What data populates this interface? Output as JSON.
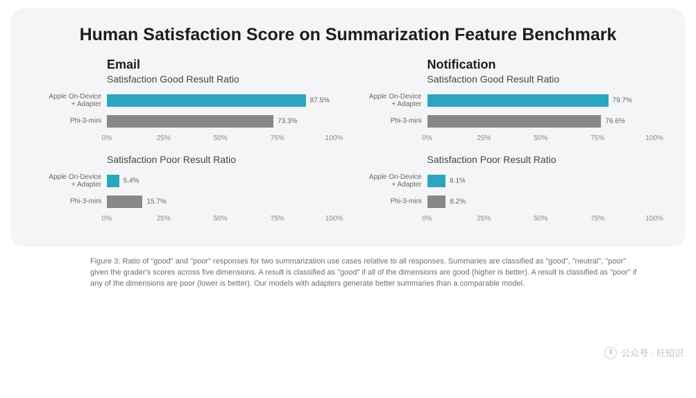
{
  "title": "Human Satisfaction Score on Summarization Feature Benchmark",
  "columns": [
    {
      "head": "Email",
      "good": {
        "sub": "Satisfaction Good Result Ratio",
        "rows": [
          {
            "label": "Apple On-Device\n+ Adapter",
            "value": 87.5,
            "text": "87.5%",
            "color": "teal"
          },
          {
            "label": "Phi-3-mini",
            "value": 73.3,
            "text": "73.3%",
            "color": "gray"
          }
        ]
      },
      "poor": {
        "sub": "Satisfaction Poor Result Ratio",
        "rows": [
          {
            "label": "Apple On-Device\n+ Adapter",
            "value": 5.4,
            "text": "5.4%",
            "color": "teal"
          },
          {
            "label": "Phi-3-mini",
            "value": 15.7,
            "text": "15.7%",
            "color": "gray"
          }
        ]
      }
    },
    {
      "head": "Notification",
      "good": {
        "sub": "Satisfaction Good Result Ratio",
        "rows": [
          {
            "label": "Apple On-Device\n+ Adapter",
            "value": 79.7,
            "text": "79.7%",
            "color": "teal"
          },
          {
            "label": "Phi-3-mini",
            "value": 76.6,
            "text": "76.6%",
            "color": "gray"
          }
        ]
      },
      "poor": {
        "sub": "Satisfaction Poor Result Ratio",
        "rows": [
          {
            "label": "Apple On-Device\n+ Adapter",
            "value": 8.1,
            "text": "8.1%",
            "color": "teal"
          },
          {
            "label": "Phi-3-mini",
            "value": 8.2,
            "text": "8.2%",
            "color": "gray"
          }
        ]
      }
    }
  ],
  "ticks": [
    "0%",
    "25%",
    "50%",
    "75%",
    "100%"
  ],
  "caption": "Figure 3: Ratio of \"good\" and \"poor\" responses for two summarization use cases relative to all responses. Summaries are classified as \"good\", \"neutral\", \"poor\" given the grader's scores across five dimensions. A result is classified as \"good\" if all of the dimensions are good (higher is better). A result is classified as \"poor\" if any of the dimensions are poor (lower is better). Our models with adapters generate better summaries than a comparable model.",
  "watermark": "公众号 · 旺知识",
  "chart_data": [
    {
      "type": "bar",
      "title": "Email — Satisfaction Good Result Ratio",
      "categories": [
        "Apple On-Device + Adapter",
        "Phi-3-mini"
      ],
      "values": [
        87.5,
        73.3
      ],
      "xlabel": "",
      "ylabel": "",
      "ylim": [
        0,
        100
      ]
    },
    {
      "type": "bar",
      "title": "Email — Satisfaction Poor Result Ratio",
      "categories": [
        "Apple On-Device + Adapter",
        "Phi-3-mini"
      ],
      "values": [
        5.4,
        15.7
      ],
      "xlabel": "",
      "ylabel": "",
      "ylim": [
        0,
        100
      ]
    },
    {
      "type": "bar",
      "title": "Notification — Satisfaction Good Result Ratio",
      "categories": [
        "Apple On-Device + Adapter",
        "Phi-3-mini"
      ],
      "values": [
        79.7,
        76.6
      ],
      "xlabel": "",
      "ylabel": "",
      "ylim": [
        0,
        100
      ]
    },
    {
      "type": "bar",
      "title": "Notification — Satisfaction Poor Result Ratio",
      "categories": [
        "Apple On-Device + Adapter",
        "Phi-3-mini"
      ],
      "values": [
        8.1,
        8.2
      ],
      "xlabel": "",
      "ylabel": "",
      "ylim": [
        0,
        100
      ]
    }
  ]
}
